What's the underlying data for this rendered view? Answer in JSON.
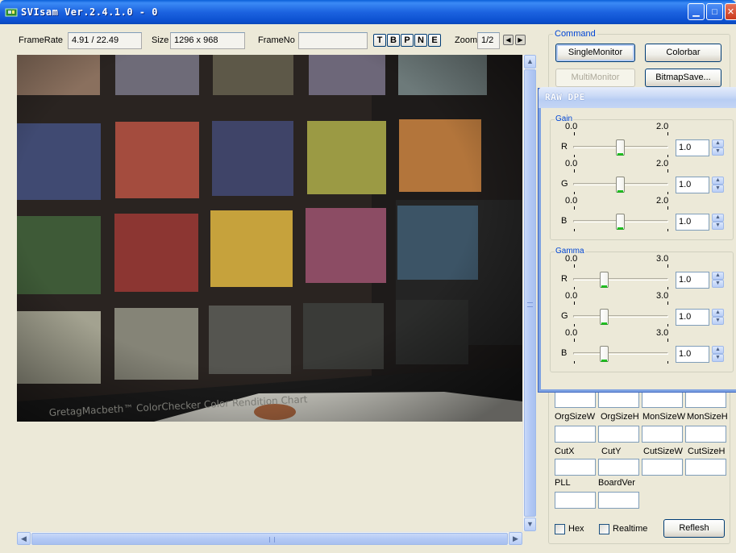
{
  "window": {
    "title": "SVIsam Ver.2.4.1.0 - 0"
  },
  "info": {
    "framerate_label": "FrameRate",
    "framerate_value": "4.91 / 22.49",
    "size_label": "Size",
    "size_value": "1296 x 968",
    "frameno_label": "FrameNo",
    "frameno_value": "",
    "mode_buttons": [
      "T",
      "B",
      "P",
      "N",
      "E"
    ],
    "zoom_label": "Zoom",
    "zoom_value": "1/2"
  },
  "image": {
    "chart_caption": "GretagMacbeth™ ColorChecker Color Rendition Chart"
  },
  "command": {
    "legend": "Command",
    "single_monitor": "SingleMonitor",
    "colorbar": "Colorbar",
    "multi_monitor": "MultiMonitor",
    "bitmap_save": "BitmapSave...",
    "labels_row1": [
      "OrgSizeW",
      "OrgSizeH",
      "MonSizeW",
      "MonSizeH"
    ],
    "labels_row2": [
      "CutX",
      "CutY",
      "CutSizeW",
      "CutSizeH"
    ],
    "labels_row3": [
      "PLL",
      "BoardVer"
    ],
    "hex_label": "Hex",
    "realtime_label": "Realtime",
    "refresh": "Reflesh"
  },
  "dpe": {
    "title": "RAW DPE",
    "gain": {
      "legend": "Gain",
      "rows": [
        {
          "channel": "R",
          "min": "0.0",
          "max": "2.0",
          "value": "1.0",
          "level": 0.5
        },
        {
          "channel": "G",
          "min": "0.0",
          "max": "2.0",
          "value": "1.0",
          "level": 0.5
        },
        {
          "channel": "B",
          "min": "0.0",
          "max": "2.0",
          "value": "1.0",
          "level": 0.5
        }
      ]
    },
    "gamma": {
      "legend": "Gamma",
      "rows": [
        {
          "channel": "R",
          "min": "0.0",
          "max": "3.0",
          "value": "1.0",
          "level": 0.333
        },
        {
          "channel": "G",
          "min": "0.0",
          "max": "3.0",
          "value": "1.0",
          "level": 0.333
        },
        {
          "channel": "B",
          "min": "0.0",
          "max": "3.0",
          "value": "1.0",
          "level": 0.333
        }
      ]
    }
  }
}
